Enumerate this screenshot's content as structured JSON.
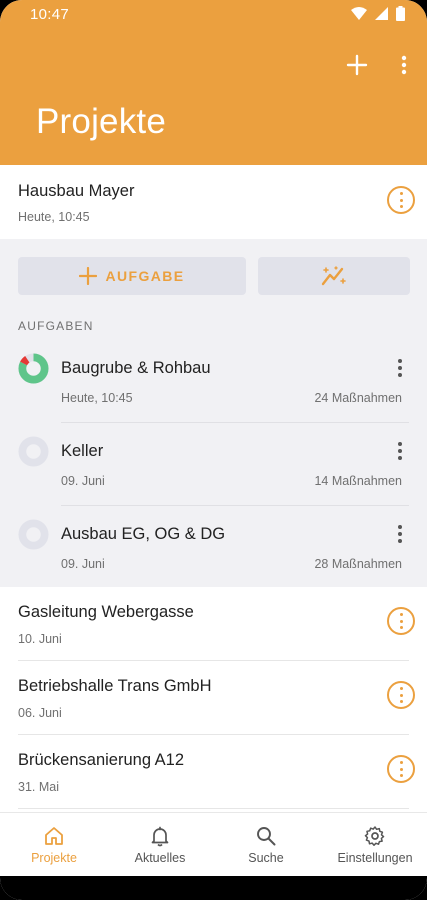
{
  "status_bar": {
    "time": "10:47"
  },
  "header": {
    "title": "Projekte"
  },
  "selected_project": {
    "title": "Hausbau Mayer",
    "date": "Heute, 10:45"
  },
  "actions": {
    "add_task_label": "AUFGABE"
  },
  "tasks_section": {
    "label": "AUFGABEN",
    "tasks": [
      {
        "title": "Baugrube & Rohbau",
        "date": "Heute, 10:45",
        "count": "24 Maßnahmen",
        "progress_done": 0.82,
        "progress_issue": 0.08
      },
      {
        "title": "Keller",
        "date": "09. Juni",
        "count": "14 Maßnahmen",
        "progress_done": 0,
        "progress_issue": 0
      },
      {
        "title": "Ausbau EG, OG & DG",
        "date": "09. Juni",
        "count": "28 Maßnahmen",
        "progress_done": 0,
        "progress_issue": 0
      }
    ]
  },
  "projects": [
    {
      "title": "Gasleitung Webergasse",
      "date": "10. Juni"
    },
    {
      "title": "Betriebshalle Trans GmbH",
      "date": "06. Juni"
    },
    {
      "title": "Brückensanierung A12",
      "date": "31. Mai"
    }
  ],
  "bottom_nav": [
    {
      "label": "Projekte",
      "icon": "home-icon",
      "active": true
    },
    {
      "label": "Aktuelles",
      "icon": "bell-icon",
      "active": false
    },
    {
      "label": "Suche",
      "icon": "search-icon",
      "active": false
    },
    {
      "label": "Einstellungen",
      "icon": "gear-icon",
      "active": false
    }
  ],
  "colors": {
    "accent": "#EBA03F",
    "done": "#5FC58A",
    "issue": "#E53935",
    "track": "#E1E2EA"
  }
}
